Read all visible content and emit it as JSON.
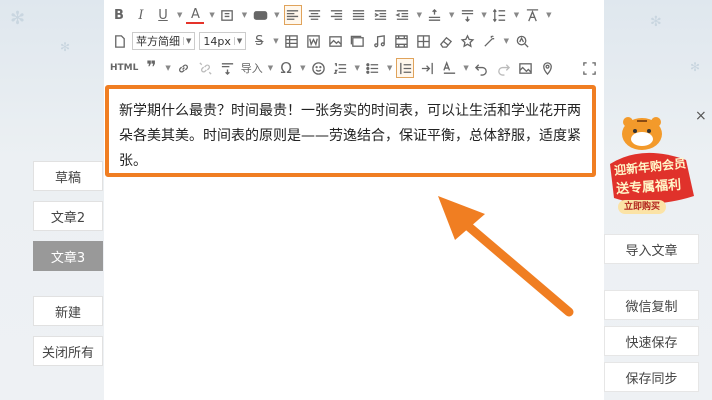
{
  "toolbar": {
    "font_family": "苹方简细",
    "font_size": "14px",
    "html_label": "HTML",
    "import_label": "导入"
  },
  "content": {
    "text": "新学期什么最贵？时间最贵！一张务实的时间表，可以让生活和学业花开两朵各美其美。时间表的原则是——劳逸结合，保证平衡，总体舒服，适度紧张。"
  },
  "left_panel": {
    "items": [
      {
        "label": "草稿"
      },
      {
        "label": "文章2"
      },
      {
        "label": "文章3",
        "active": true
      },
      {
        "label": "新建"
      },
      {
        "label": "关闭所有"
      }
    ]
  },
  "right_panel": {
    "import_article": "导入文章",
    "wechat_copy": "微信复制",
    "quick_save": "快速保存",
    "save_sync": "保存同步"
  },
  "promo": {
    "line1": "迎新年购会员",
    "line2": "送专属福利",
    "cta": "立即购买",
    "close": "×"
  },
  "colors": {
    "highlight_border": "#f07e22",
    "arrow": "#f07e22",
    "promo_red": "#e0322b"
  }
}
